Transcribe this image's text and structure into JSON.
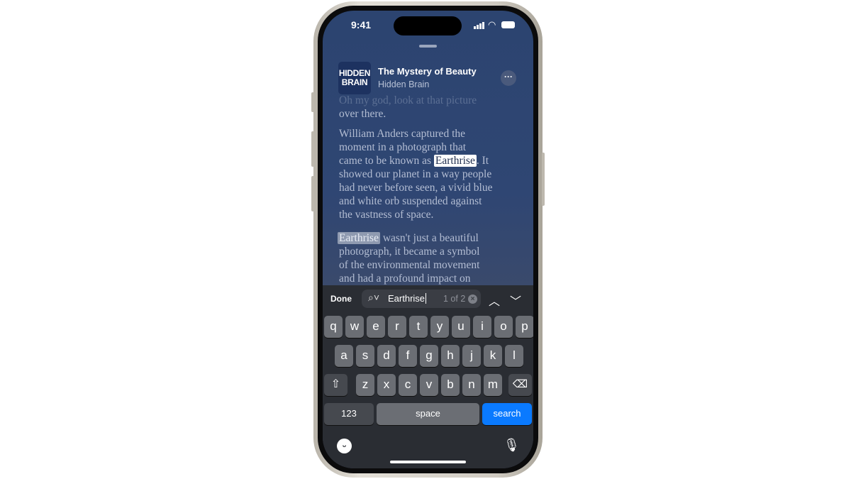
{
  "status": {
    "time": "9:41"
  },
  "episode": {
    "title": "The Mystery of Beauty",
    "show": "Hidden Brain",
    "art_line1": "HIDDEN",
    "art_line2": "BRAIN"
  },
  "transcript": {
    "faded": "Oh my god, look at that picture",
    "l1": "over there.",
    "p2": [
      "William Anders captured the",
      "moment in a photograph that",
      "came to be known as ",
      "Earthrise",
      ". It",
      "showed our planet in a way people",
      "had never before seen, a vivid blue",
      "and white orb suspended against",
      "the vastness of space."
    ],
    "p3": [
      "Earthrise",
      " wasn't just a beautiful",
      "photograph, it became a symbol",
      "of the environmental movement",
      "and had a profound impact on"
    ]
  },
  "find": {
    "done": "Done",
    "query": "Earthrise",
    "count": "1 of 2"
  },
  "keyboard": {
    "row1": [
      "q",
      "w",
      "e",
      "r",
      "t",
      "y",
      "u",
      "i",
      "o",
      "p"
    ],
    "row2": [
      "a",
      "s",
      "d",
      "f",
      "g",
      "h",
      "j",
      "k",
      "l"
    ],
    "row3": [
      "z",
      "x",
      "c",
      "v",
      "b",
      "n",
      "m"
    ],
    "numbers": "123",
    "space": "space",
    "search": "search",
    "accent": "#0a7aff"
  }
}
